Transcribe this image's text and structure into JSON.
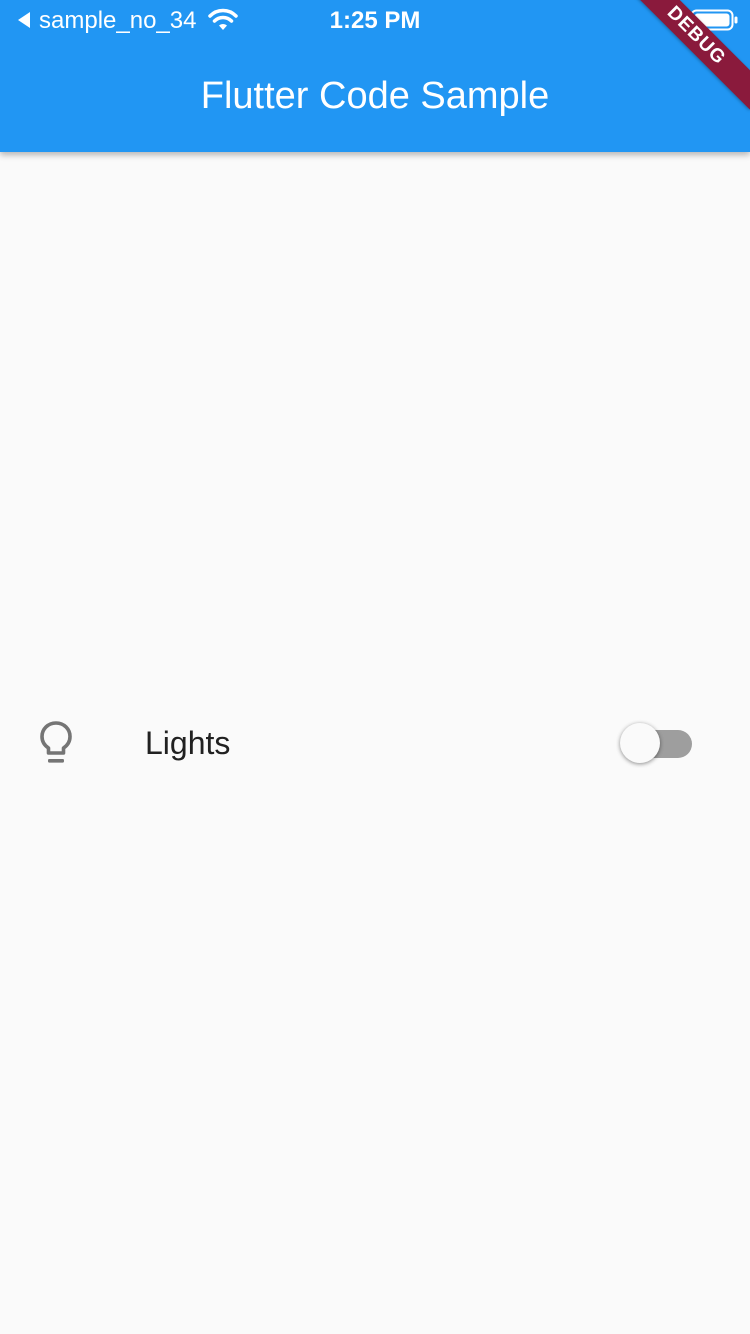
{
  "status_bar": {
    "back_app": "sample_no_34",
    "time": "1:25 PM"
  },
  "app_bar": {
    "title": "Flutter Code Sample",
    "debug_label": "DEBUG"
  },
  "content": {
    "tile": {
      "icon": "lightbulb-outline-icon",
      "label": "Lights",
      "switch_on": false
    }
  },
  "colors": {
    "primary": "#2196f3",
    "background": "#fafafa",
    "debug_banner": "#8a1a3c",
    "switch_track_off": "#9e9e9e"
  }
}
